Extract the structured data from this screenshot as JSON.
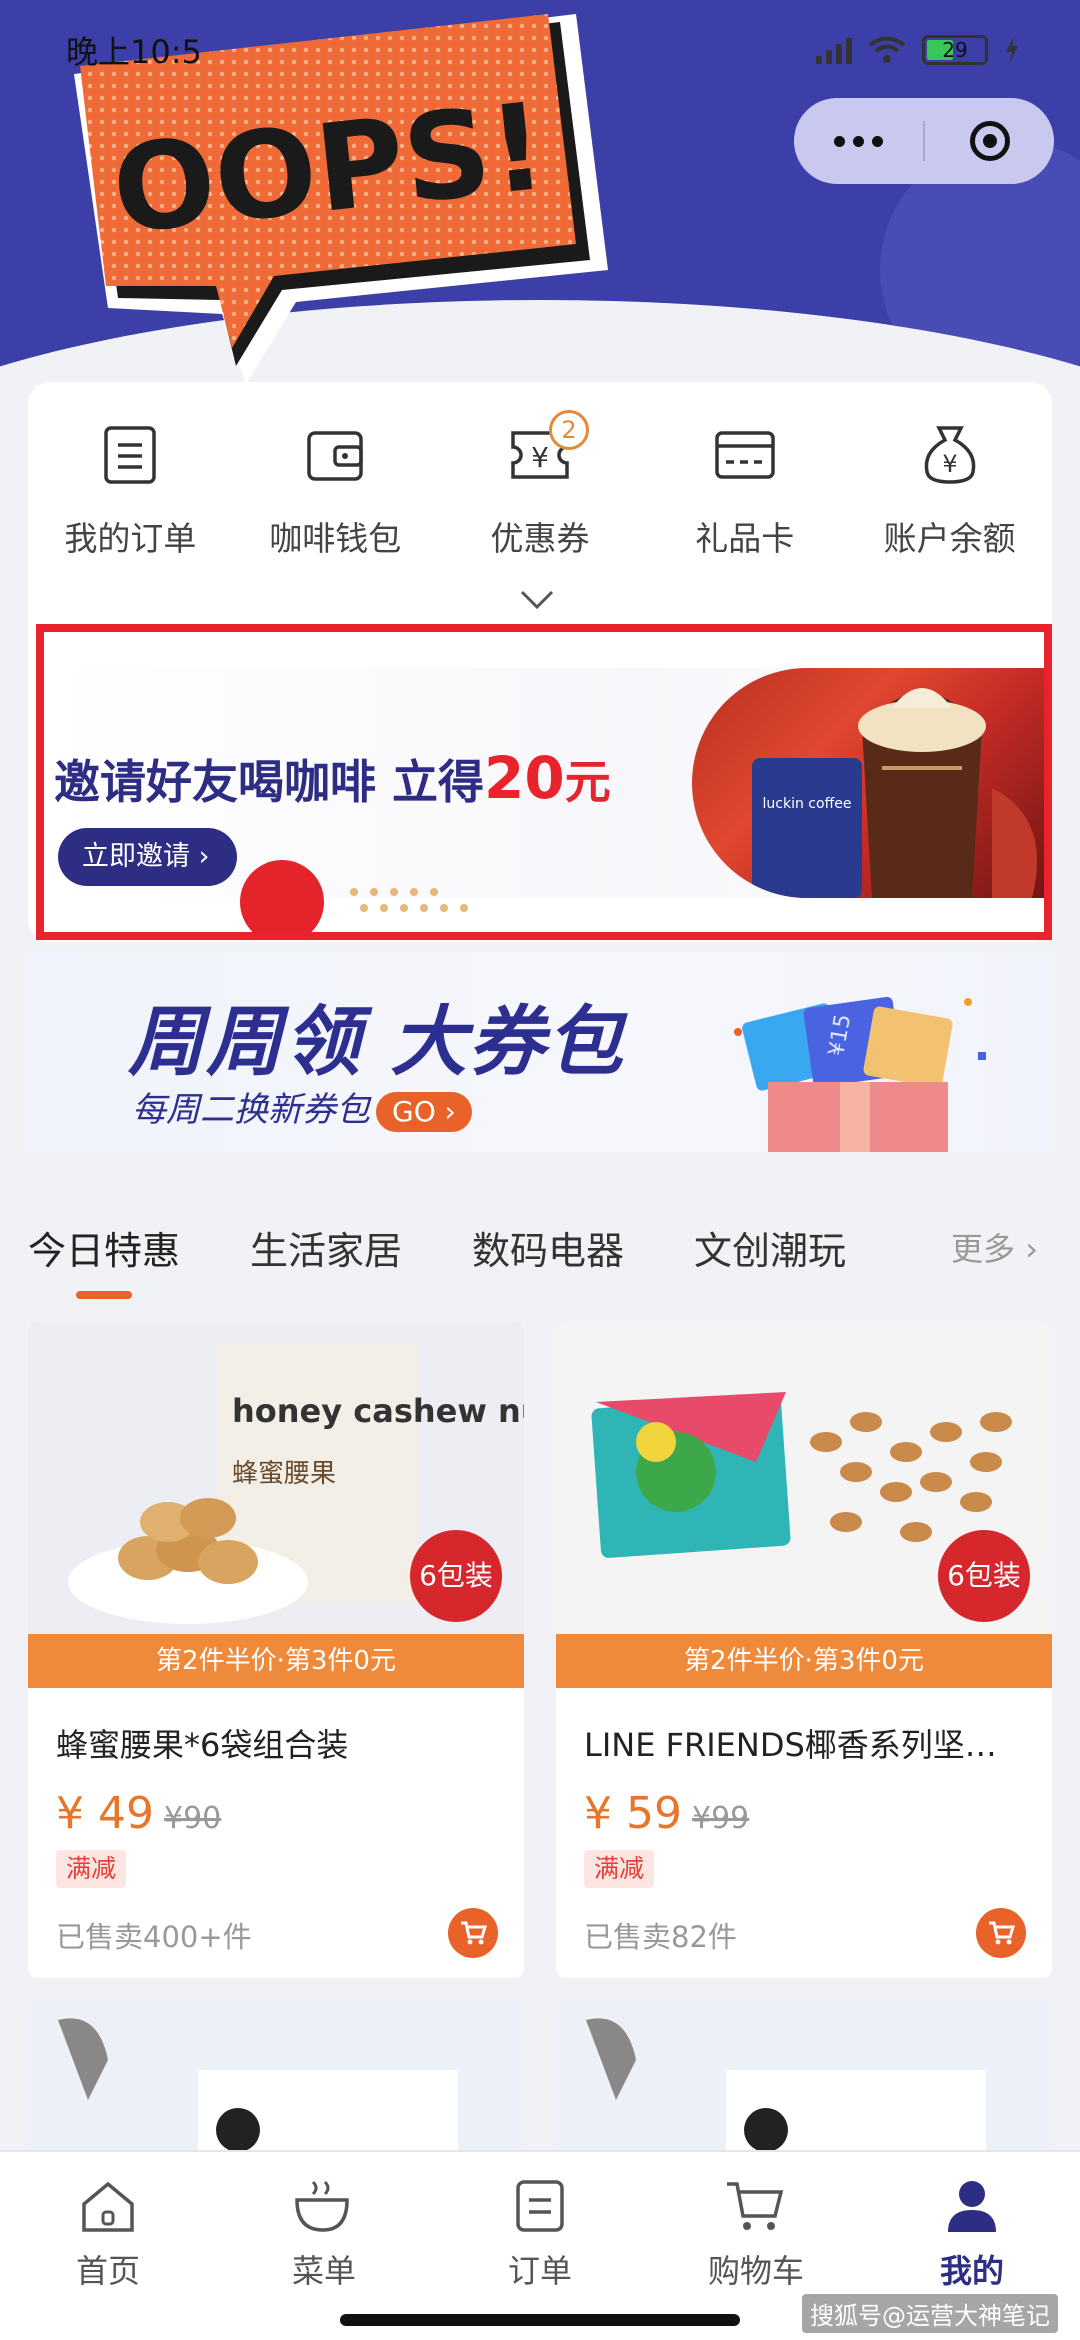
{
  "status_bar": {
    "time": "晚上10:5",
    "battery": "29"
  },
  "header_sticker": {
    "text": "OOPS!"
  },
  "menu": [
    {
      "label": "我的订单",
      "icon": "order-list-icon"
    },
    {
      "label": "咖啡钱包",
      "icon": "wallet-icon"
    },
    {
      "label": "优惠券",
      "icon": "coupon-icon",
      "badge": "2"
    },
    {
      "label": "礼品卡",
      "icon": "gift-card-icon"
    },
    {
      "label": "账户余额",
      "icon": "money-bag-icon"
    }
  ],
  "invite_banner": {
    "title": "邀请好友喝咖啡 立得",
    "amount": "20",
    "unit": "元",
    "button": "立即邀请",
    "brand": "luckin coffee"
  },
  "coupon_banner": {
    "title": "周周领 大券包",
    "subtitle": "每周二换新券包",
    "go": "GO",
    "ticket_text": "¥15"
  },
  "tabs": [
    {
      "label": "今日特惠",
      "active": true
    },
    {
      "label": "生活家居"
    },
    {
      "label": "数码电器"
    },
    {
      "label": "文创潮玩"
    }
  ],
  "tabs_more": "更多",
  "products": [
    {
      "name": "蜂蜜腰果*6袋组合装",
      "badge": "6包装",
      "promo": "第2件半价·第3件0元",
      "currency": "¥",
      "price": "49",
      "orig_price": "¥90",
      "tag": "满减",
      "sold": "已售卖400+件",
      "package_text": "honey cashew nuts",
      "package_cn": "蜂蜜腰果"
    },
    {
      "name": "LINE FRIENDS椰香系列坚…",
      "badge": "6包装",
      "promo": "第2件半价·第3件0元",
      "currency": "¥",
      "price": "59",
      "orig_price": "¥99",
      "tag": "满减",
      "sold": "已售卖82件"
    }
  ],
  "bottom_tabs": [
    {
      "label": "首页",
      "icon": "home-icon"
    },
    {
      "label": "菜单",
      "icon": "coffee-cup-icon"
    },
    {
      "label": "订单",
      "icon": "order-icon"
    },
    {
      "label": "购物车",
      "icon": "cart-icon"
    },
    {
      "label": "我的",
      "icon": "profile-icon",
      "active": true
    }
  ],
  "watermark": "搜狐号@运营大神笔记",
  "colors": {
    "brand_blue": "#2e2d84",
    "header_blue": "#3d3fa8",
    "accent_orange": "#e8622a",
    "highlight_red": "#e8232b"
  }
}
